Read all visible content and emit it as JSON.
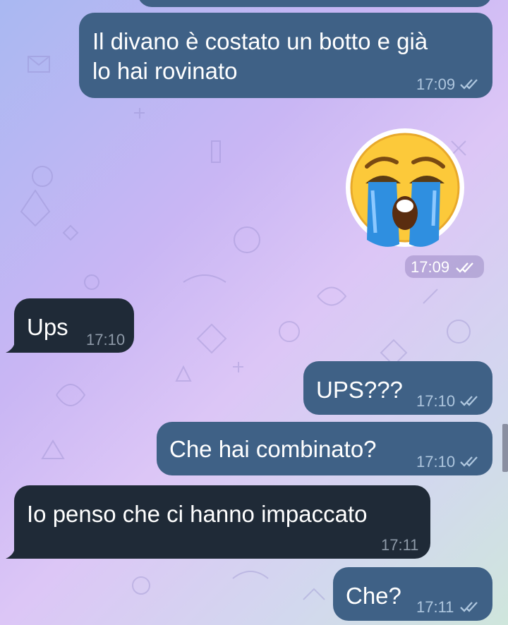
{
  "messages": [
    {
      "id": "m1",
      "direction": "outgoing",
      "text_lines": [
        "Il divano è costato un botto e già",
        "lo hai rovinato"
      ],
      "time": "17:09",
      "status": "read"
    },
    {
      "id": "m2",
      "direction": "outgoing",
      "type": "sticker",
      "sticker": "crying-face",
      "time": "17:09",
      "status": "read"
    },
    {
      "id": "m3",
      "direction": "incoming",
      "text": "Ups",
      "time": "17:10"
    },
    {
      "id": "m4",
      "direction": "outgoing",
      "text": "UPS???",
      "time": "17:10",
      "status": "read"
    },
    {
      "id": "m5",
      "direction": "outgoing",
      "text": "Che hai combinato?",
      "time": "17:10",
      "status": "read"
    },
    {
      "id": "m6",
      "direction": "incoming",
      "text": "Io penso che ci hanno impaccato",
      "time": "17:11"
    },
    {
      "id": "m7",
      "direction": "outgoing",
      "text": "Che?",
      "time": "17:11",
      "status": "read"
    }
  ],
  "colors": {
    "outgoing_bubble": "#3f6186",
    "incoming_bubble": "#1f2a37",
    "read_check": "#aec6de",
    "background_start": "#a9b8f2",
    "background_end": "#cfe6dc"
  },
  "icons": {
    "read_receipt": "double-check-icon",
    "sticker": "crying-face-icon"
  }
}
